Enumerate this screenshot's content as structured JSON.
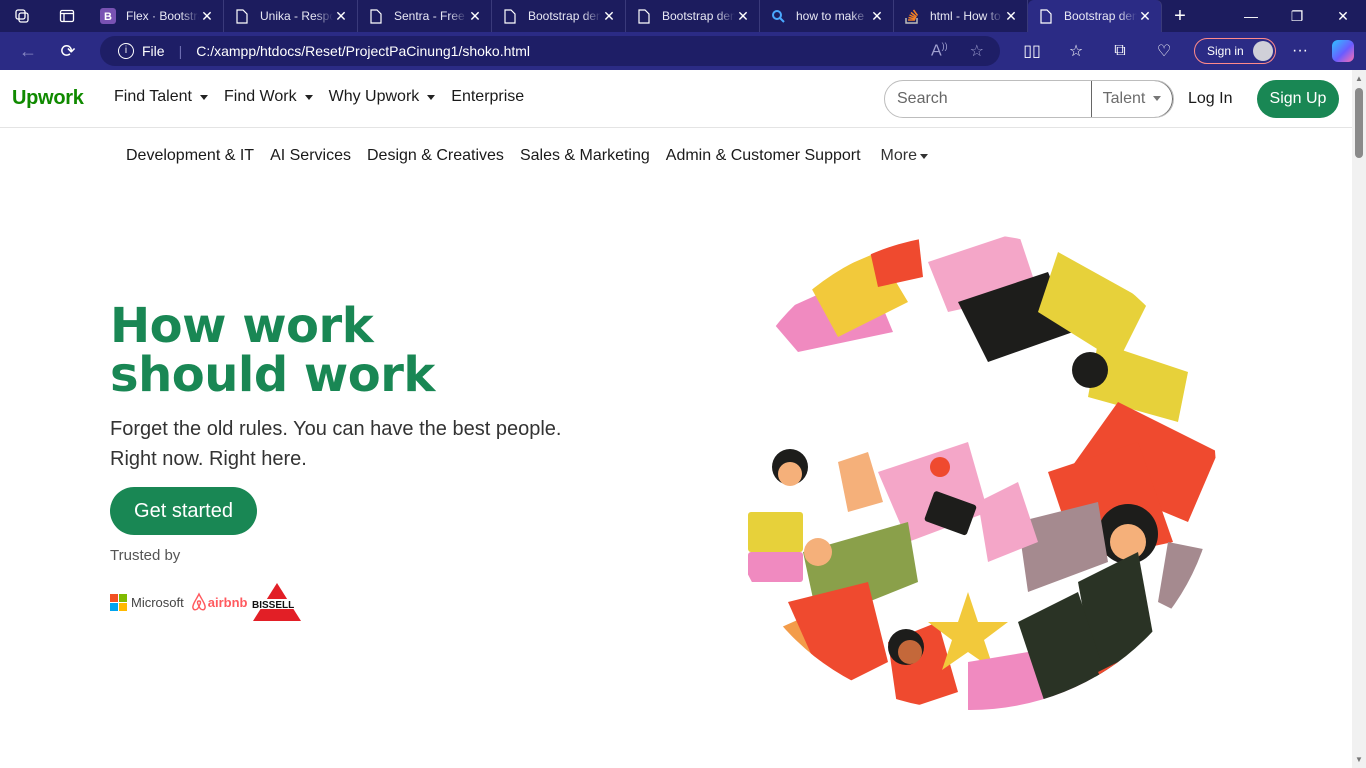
{
  "browser": {
    "tabs": [
      {
        "title": "Flex · Bootstrap",
        "favicon": "bootstrap-icon",
        "active": false
      },
      {
        "title": "Unika - Responsive",
        "favicon": "page-icon",
        "active": false
      },
      {
        "title": "Sentra - Free",
        "favicon": "page-icon",
        "active": false
      },
      {
        "title": "Bootstrap demo",
        "favicon": "page-icon",
        "active": false
      },
      {
        "title": "Bootstrap demo",
        "favicon": "page-icon",
        "active": false
      },
      {
        "title": "how to make",
        "favicon": "search-icon",
        "active": false
      },
      {
        "title": "html - How to",
        "favicon": "stackoverflow-icon",
        "active": false
      },
      {
        "title": "Bootstrap demo",
        "favicon": "page-icon",
        "active": true
      }
    ],
    "address": {
      "scheme_label": "File",
      "url": "C:/xampp/htdocs/Reset/ProjectPaCinung1/shoko.html"
    },
    "signin_label": "Sign in",
    "colors": {
      "tabbar": "#1c1c5e",
      "toolbar": "#2b2b85"
    }
  },
  "nav": {
    "logo": "Upwork",
    "menu": [
      {
        "label": "Find Talent",
        "dropdown": true
      },
      {
        "label": "Find Work",
        "dropdown": true
      },
      {
        "label": "Why Upwork",
        "dropdown": true
      },
      {
        "label": "Enterprise",
        "dropdown": false
      }
    ],
    "search_placeholder": "Search",
    "search_scope": "Talent",
    "login": "Log In",
    "signup": "Sign Up"
  },
  "categories": {
    "items": [
      "Development & IT",
      "AI Services",
      "Design & Creatives",
      "Sales & Marketing",
      "Admin & Customer Support"
    ],
    "more": "More"
  },
  "hero": {
    "title_line1": "How work",
    "title_line2": "should work",
    "subtitle_line1": "Forget the old rules. You can have the best people.",
    "subtitle_line2": "Right now. Right here.",
    "cta": "Get started",
    "trusted_by": "Trusted by",
    "brands": {
      "microsoft": "Microsoft",
      "airbnb": "airbnb",
      "bissell": "BISSELL"
    }
  },
  "colors": {
    "brand_green": "#198754",
    "logo_green": "#108a00"
  }
}
